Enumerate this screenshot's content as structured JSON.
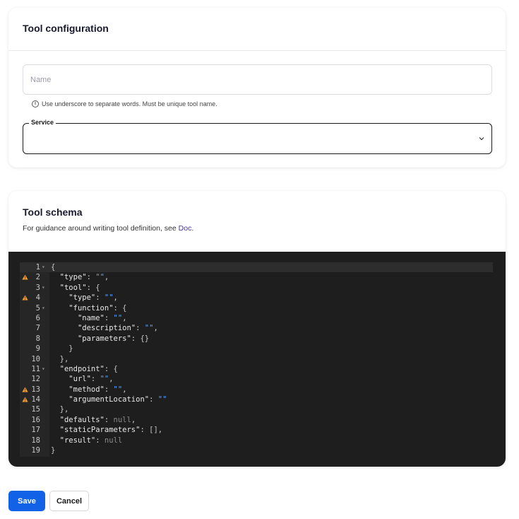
{
  "config": {
    "title": "Tool configuration",
    "name_placeholder": "Name",
    "name_value": "",
    "helper_text": "Use underscore to separate words. Must be unique tool name.",
    "service_label": "Service",
    "service_value": ""
  },
  "schema": {
    "title": "Tool schema",
    "description_prefix": "For guidance around writing tool definition, see ",
    "doc_link": "Doc",
    "description_suffix": ".",
    "lines": [
      {
        "n": "1",
        "code": "{"
      },
      {
        "n": "2",
        "code": "  \"type\": \"\","
      },
      {
        "n": "3",
        "code": "  \"tool\": {"
      },
      {
        "n": "4",
        "code": "    \"type\": \"\","
      },
      {
        "n": "5",
        "code": "    \"function\": {"
      },
      {
        "n": "6",
        "code": "      \"name\": \"\","
      },
      {
        "n": "7",
        "code": "      \"description\": \"\","
      },
      {
        "n": "8",
        "code": "      \"parameters\": {}"
      },
      {
        "n": "9",
        "code": "    }"
      },
      {
        "n": "10",
        "code": "  },"
      },
      {
        "n": "11",
        "code": "  \"endpoint\": {"
      },
      {
        "n": "12",
        "code": "    \"url\": \"\","
      },
      {
        "n": "13",
        "code": "    \"method\": \"\","
      },
      {
        "n": "14",
        "code": "    \"argumentLocation\": \"\""
      },
      {
        "n": "15",
        "code": "  },"
      },
      {
        "n": "16",
        "code": "  \"defaults\": null,"
      },
      {
        "n": "17",
        "code": "  \"staticParameters\": [],"
      },
      {
        "n": "18",
        "code": "  \"result\": null"
      },
      {
        "n": "19",
        "code": "}"
      }
    ],
    "warning_lines": [
      "2",
      "4",
      "13",
      "14"
    ],
    "fold_lines": [
      "1",
      "3",
      "5",
      "11"
    ]
  },
  "actions": {
    "save_label": "Save",
    "cancel_label": "Cancel"
  },
  "colors": {
    "primary": "#1262e8",
    "link": "#4b2fa0",
    "editor_bg": "#1e1e1e",
    "string": "#58a6ff",
    "warning": "#f0a030"
  },
  "icons": {
    "helper": "info-icon",
    "service": "chevron-down-icon",
    "lint": "warning-icon",
    "fold": "fold-arrow-icon"
  }
}
